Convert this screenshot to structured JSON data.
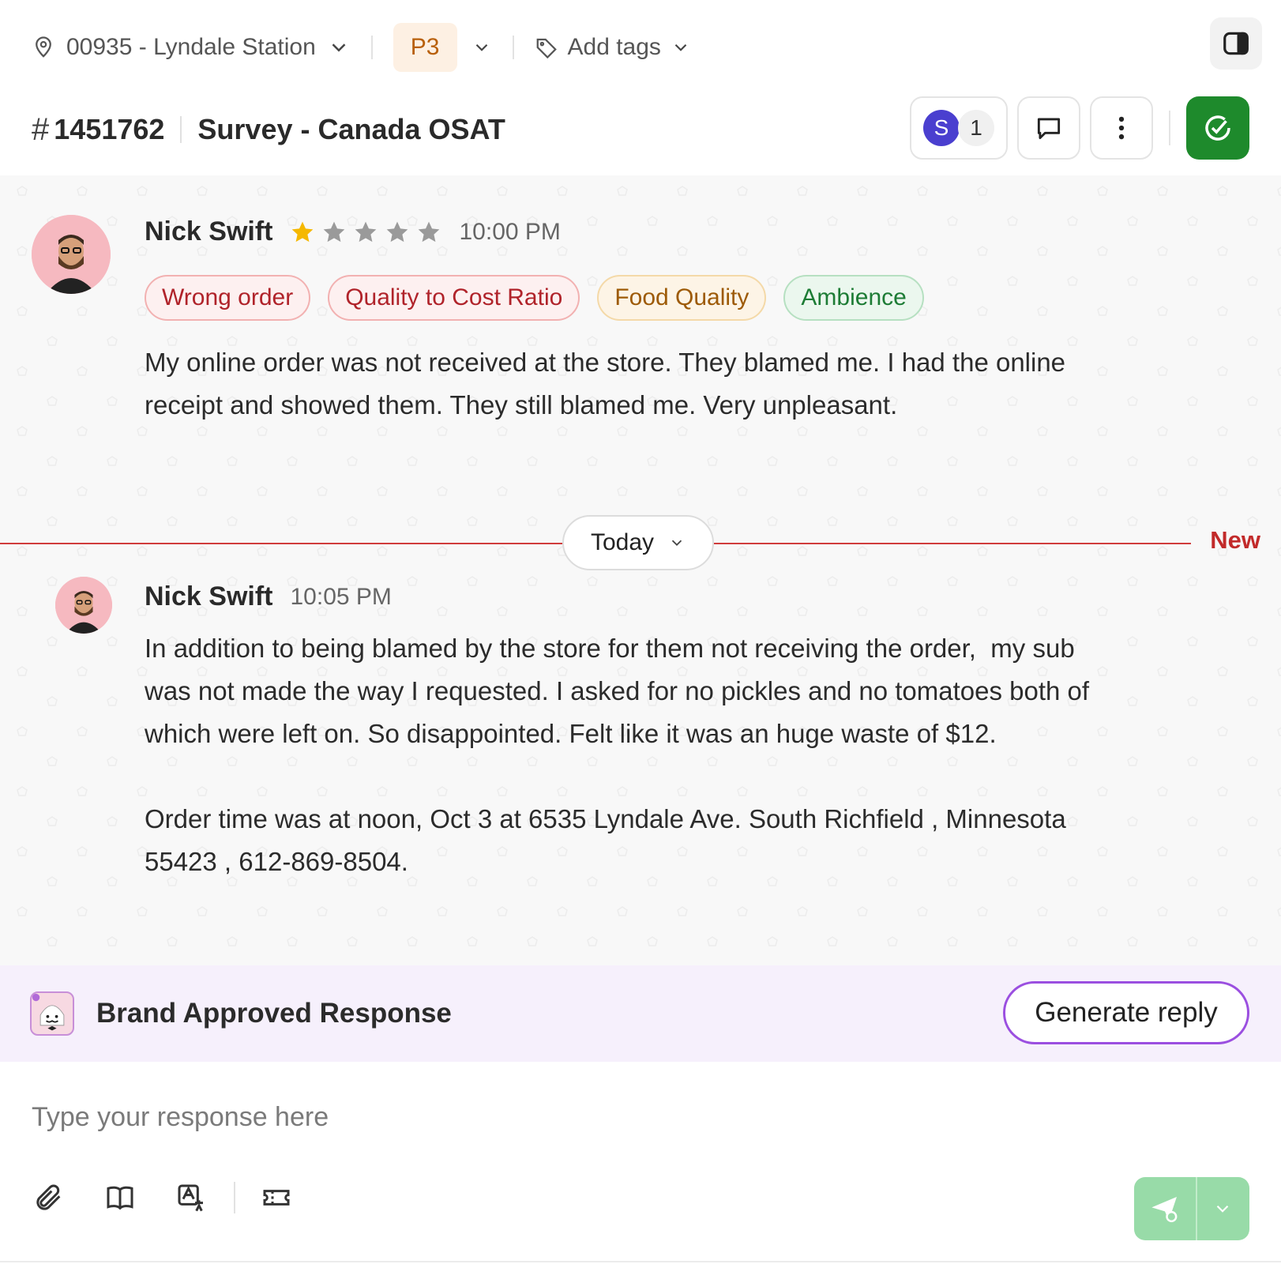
{
  "topbar": {
    "location": "00935 - Lyndale Station",
    "priority": "P3",
    "tags_label": "Add tags"
  },
  "ticket": {
    "hash": "#",
    "number": "1451762",
    "title": "Survey - Canada OSAT"
  },
  "actions": {
    "assignee_initial": "S",
    "assignee_count": "1"
  },
  "messages": [
    {
      "author": "Nick Swift",
      "rating": 1,
      "rating_max": 5,
      "time": "10:00 PM",
      "tags": [
        {
          "label": "Wrong order",
          "tone": "red"
        },
        {
          "label": "Quality to Cost Ratio",
          "tone": "red"
        },
        {
          "label": "Food Quality",
          "tone": "orange"
        },
        {
          "label": "Ambience",
          "tone": "green"
        }
      ],
      "lines": [
        "My online order was not received at the store. They blamed me. I had the online",
        "receipt and showed them. They still blamed me. Very unpleasant."
      ]
    },
    {
      "author": "Nick Swift",
      "time": "10:05 PM",
      "lines": [
        "In addition to being blamed by the store for them not receiving the order,  my sub",
        "was not made the way I requested. I asked for no pickles and no tomatoes both of",
        "which were left on. So disappointed. Felt like it was an huge waste of $12.",
        "",
        "Order time was at noon, Oct 3 at 6535 Lyndale Ave. South Richfield , Minnesota",
        "55423 , 612-869-8504."
      ]
    }
  ],
  "divider": {
    "label": "Today",
    "new_label": "New"
  },
  "brand": {
    "title": "Brand Approved Response",
    "generate_label": "Generate reply"
  },
  "composer": {
    "placeholder": "Type your response here",
    "value": ""
  },
  "colors": {
    "accent_red": "#d03c3c",
    "resolve_green": "#1e8a2c",
    "send_green": "#98dba8",
    "brand_purple": "#9b4fe0",
    "star_filled": "#f5b800",
    "star_empty": "#9a9a9a"
  },
  "icons": {
    "location": "map-pin-icon",
    "tags": "tag-icon",
    "panel": "sidebar-toggle-icon",
    "comment": "comment-icon",
    "more": "more-vertical-icon",
    "resolve": "check-circle-icon",
    "attach": "paperclip-icon",
    "knowledge": "book-icon",
    "translate": "translate-icon",
    "coupon": "ticket-icon",
    "send": "send-icon"
  }
}
